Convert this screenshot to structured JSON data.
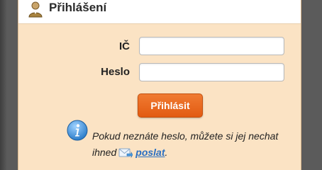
{
  "header": {
    "title": "Přihlášení",
    "icon": "user-icon"
  },
  "form": {
    "ico_label": "IČ",
    "ico_value": "",
    "heslo_label": "Heslo",
    "heslo_value": "",
    "submit_label": "Přihlásit"
  },
  "info": {
    "icon": "info-icon",
    "line1": "Pokud neznáte heslo, můžete si jej nechat",
    "line2_prefix": "ihned",
    "mail_icon": "mail-icon",
    "link_label": "poslat",
    "line2_suffix": "."
  },
  "colors": {
    "panel_bg": "#fbe3c4",
    "button": "#e8641c",
    "link": "#2a6fc2",
    "info_icon": "#3d8fd6"
  }
}
